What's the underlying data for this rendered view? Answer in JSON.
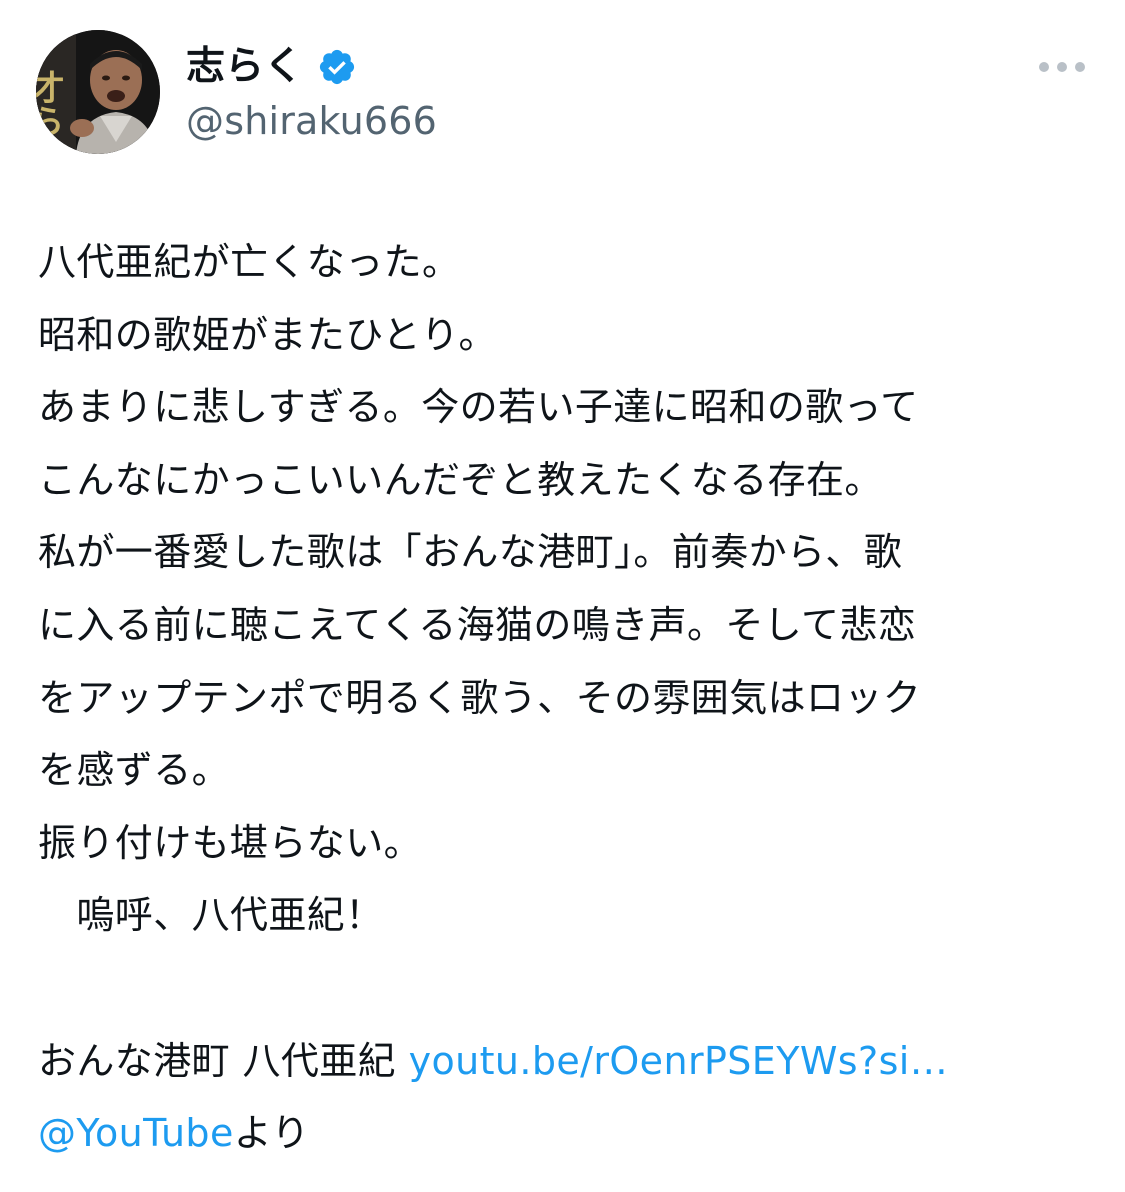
{
  "author": {
    "display_name": "志らく",
    "handle": "@shiraku666",
    "avatar_sign_text": "才らく",
    "verified_color": "#1d9bf0"
  },
  "icons": {
    "verified": "verified-badge-icon",
    "more": "more-horizontal-icon"
  },
  "tweet": {
    "lines": [
      "八代亜紀が亡くなった。",
      "昭和の歌姫がまたひとり。",
      "あまりに悲しすぎる。今の若い子達に昭和の歌って",
      "こんなにかっこいいんだぞと教えたくなる存在。",
      "私が一番愛した歌は「おんな港町」。前奏から、歌",
      "に入る前に聴こえてくる海猫の鳴き声。そして悲恋",
      "をアップテンポで明るく歌う、その雰囲気はロック",
      "を感ずる。",
      "振り付けも堪らない。",
      "　嗚呼、八代亜紀！"
    ],
    "share_text": "おんな港町 八代亜紀 ",
    "link_text": "youtu.be/rOenrPSEYWs?si…",
    "mention_text": "@YouTube",
    "mention_suffix": "より"
  },
  "colors": {
    "text": "#0f1419",
    "secondary": "#536471",
    "link": "#1d9bf0"
  }
}
